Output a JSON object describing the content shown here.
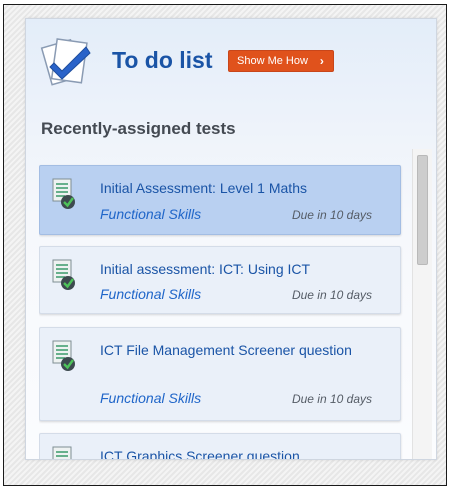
{
  "header": {
    "title": "To do list",
    "show_me_how": "Show Me How",
    "chevron": "›",
    "icon": "todo-checkmark-icon"
  },
  "section": {
    "title": "Recently-assigned tests"
  },
  "tests": [
    {
      "name": "Initial Assessment: Level 1 Maths",
      "category": "Functional Skills",
      "due": "Due in 10 days",
      "selected": true,
      "icon": "test-document-icon"
    },
    {
      "name": "Initial assessment: ICT: Using ICT",
      "category": "Functional Skills",
      "due": "Due in 10 days",
      "selected": false,
      "icon": "test-document-icon"
    },
    {
      "name": "ICT File Management Screener question",
      "category": "Functional Skills",
      "due": "Due in 10 days",
      "selected": false,
      "icon": "test-document-icon"
    },
    {
      "name": "ICT Graphics Screener question",
      "category": "",
      "due": "",
      "selected": false,
      "icon": "test-document-icon"
    }
  ],
  "colors": {
    "title_blue": "#1a54a6",
    "button_orange": "#e0521c",
    "selected_item": "#b9d0f1",
    "item_bg": "#eaf0f9"
  }
}
